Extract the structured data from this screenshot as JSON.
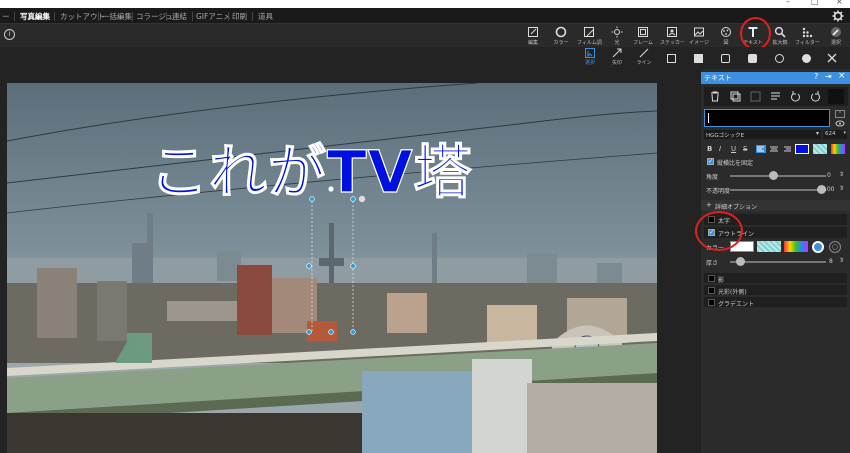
{
  "window": {
    "minimize": "–",
    "maximize": "□",
    "close": "×"
  },
  "menu": [
    "ー",
    "写真編集",
    "カットアウト",
    "一括編集",
    "コラージュ",
    "連結",
    "GIFアニメ",
    "印刷",
    "道具"
  ],
  "menu_active_index": 1,
  "info_icon": "i",
  "tools": [
    {
      "name": "edit",
      "label": "編集"
    },
    {
      "name": "color",
      "label": "カラー"
    },
    {
      "name": "film",
      "label": "フィルム調"
    },
    {
      "name": "light",
      "label": "光"
    },
    {
      "name": "frame",
      "label": "フレーム"
    },
    {
      "name": "sticker",
      "label": "ステッカー"
    },
    {
      "name": "image",
      "label": "イメージ"
    },
    {
      "name": "pattern",
      "label": "図"
    },
    {
      "name": "text",
      "label": "テキスト"
    },
    {
      "name": "zoom",
      "label": "拡大鏡"
    },
    {
      "name": "filter",
      "label": "フィルター"
    },
    {
      "name": "select",
      "label": "選択"
    }
  ],
  "subtools": [
    {
      "name": "select",
      "label": "選択"
    },
    {
      "name": "arrow",
      "label": "矢印"
    },
    {
      "name": "line",
      "label": "ライン"
    }
  ],
  "canvas": {
    "overlay_text": "これがTV塔"
  },
  "panel": {
    "title": "テキスト",
    "font_name": "HGGゴシックE",
    "font_size": "624",
    "format_buttons": [
      "B",
      "I",
      "U",
      "S"
    ],
    "keep_ratio_label": "縦横比を固定",
    "angle_label": "角度",
    "angle_value": "0",
    "opacity_label": "不透明度",
    "opacity_value": "100",
    "detail_label": "詳細オプション",
    "detail_expand": "+",
    "effects": [
      {
        "label": "太字",
        "checked": false
      },
      {
        "label": "アウトライン",
        "checked": true
      }
    ],
    "color_label": "カラー",
    "thickness_label": "厚さ",
    "thickness_value": "8",
    "more_effects": [
      "影",
      "光彩(外側)",
      "グラデエント"
    ]
  },
  "accent_color": "#3d8fe0",
  "text_color": "#0010e0",
  "highlight_color": "#e02020"
}
